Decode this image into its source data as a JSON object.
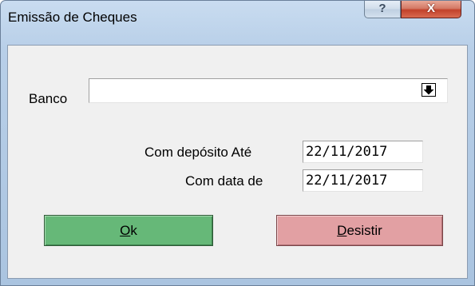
{
  "window": {
    "title": "Emissão de Cheques",
    "help_label": "?",
    "close_label": "X"
  },
  "form": {
    "banco_label": "Banco",
    "banco_value": "",
    "deposito_label": "Com depósito Até",
    "deposito_value": "22/11/2017",
    "data_label": "Com data de",
    "data_value": "22/11/2017"
  },
  "buttons": {
    "ok": {
      "mnemonic": "O",
      "rest": "k"
    },
    "desistir": {
      "mnemonic": "D",
      "rest": "esistir"
    }
  },
  "icons": {
    "dropdown": "arrow-down-icon"
  },
  "colors": {
    "ok_button": "#66b878",
    "desistir_button": "#e2a0a3",
    "close_button": "#c2412b"
  }
}
